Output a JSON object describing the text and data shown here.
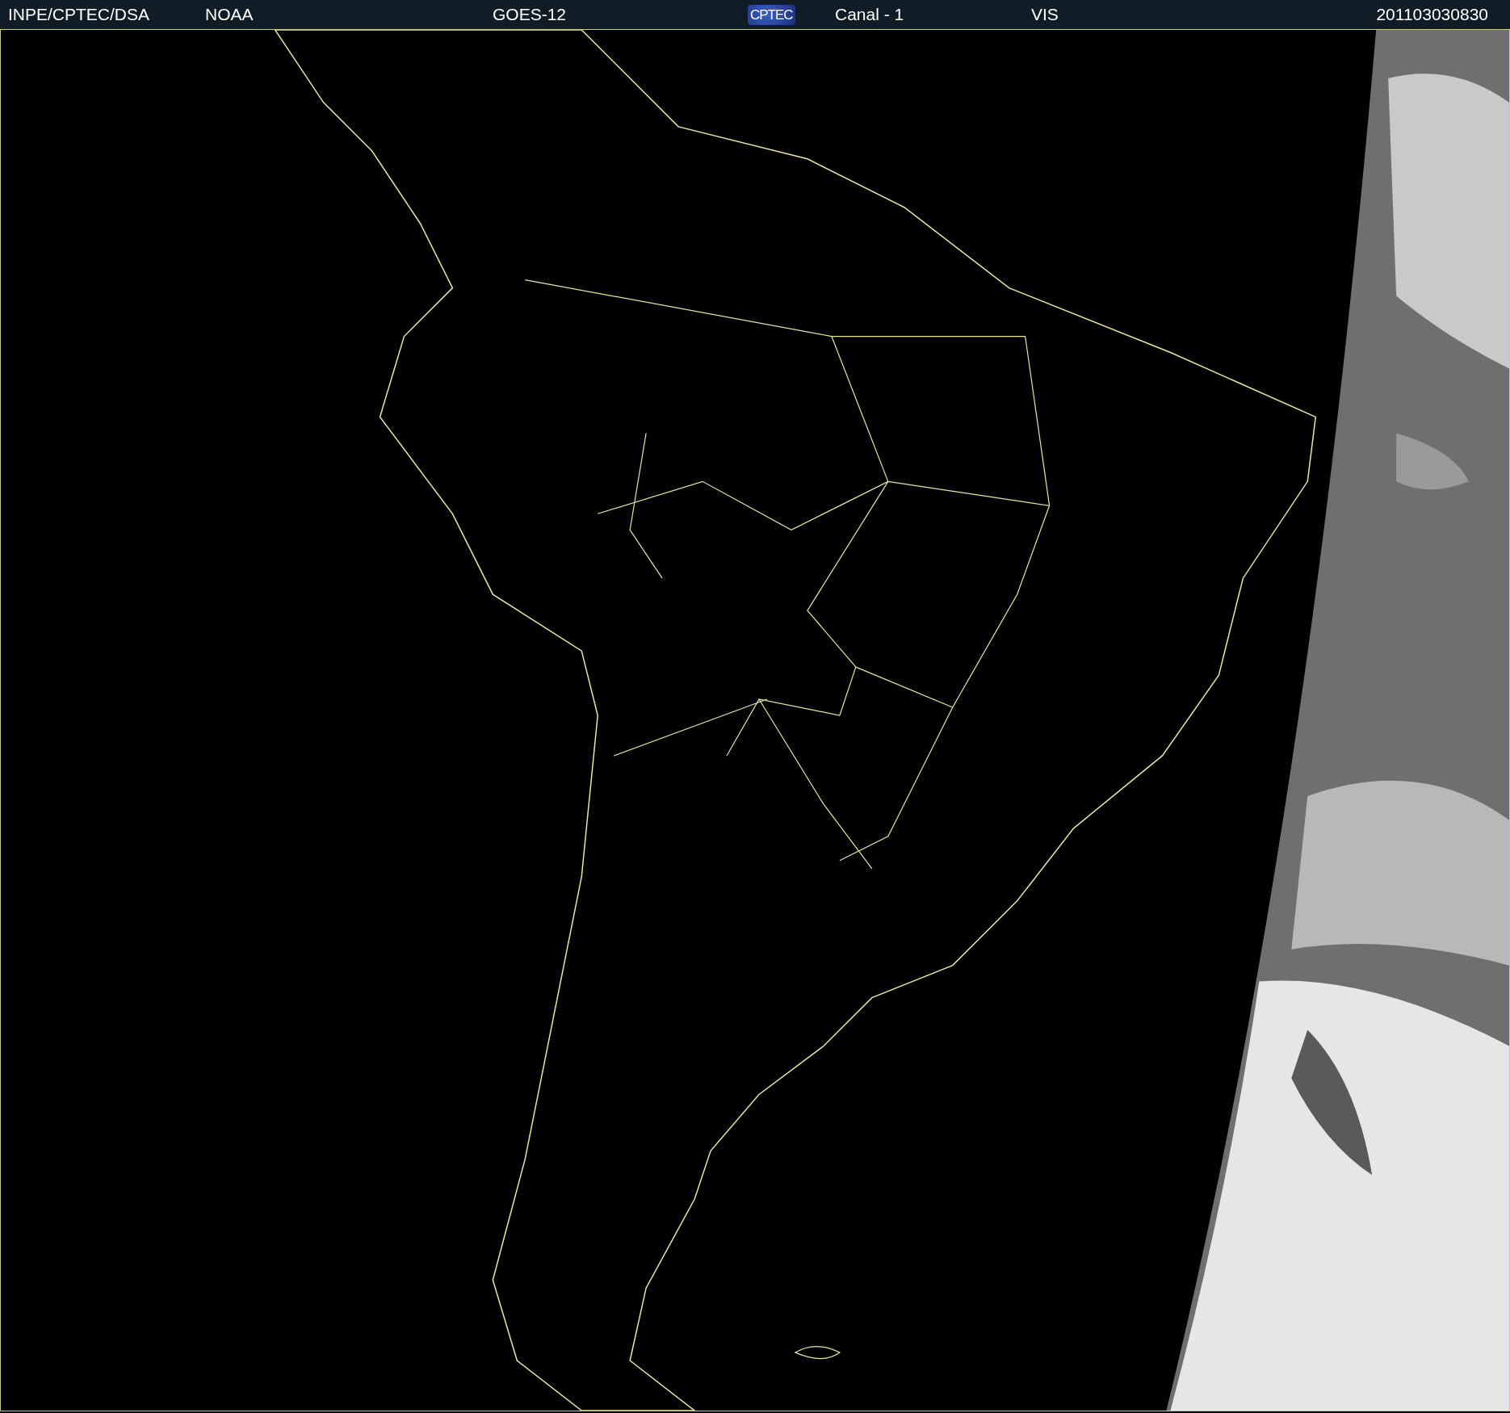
{
  "header": {
    "items": [
      {
        "kind": "text",
        "text": "INPE/CPTEC/DSA"
      },
      {
        "kind": "text",
        "text": "NOAA"
      },
      {
        "kind": "text",
        "text": "GOES-12"
      },
      {
        "kind": "logo",
        "text": "CPTEC"
      },
      {
        "kind": "text",
        "text": "Canal - 1"
      },
      {
        "kind": "text",
        "text": "VIS"
      },
      {
        "kind": "text",
        "text": "201103030830"
      }
    ]
  }
}
